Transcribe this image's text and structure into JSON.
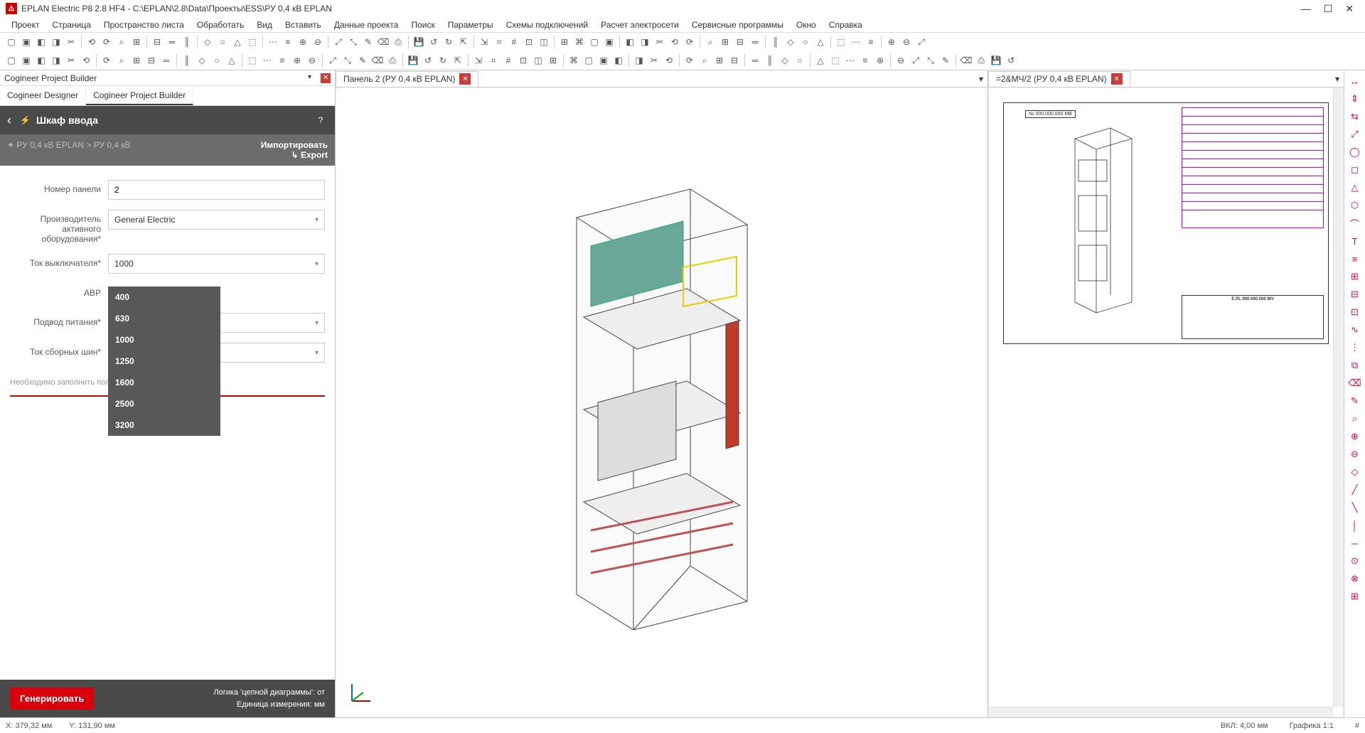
{
  "titlebar": {
    "app_title": "EPLAN Electric P8 2.8 HF4 - C:\\EPLAN\\2.8\\Data\\Проекты\\ESS\\РУ 0,4 кВ EPLAN"
  },
  "menu": [
    "Проект",
    "Страница",
    "Пространство листа",
    "Обработать",
    "Вид",
    "Вставить",
    "Данные проекта",
    "Поиск",
    "Параметры",
    "Схемы подключений",
    "Расчет электросети",
    "Сервисные программы",
    "Окно",
    "Справка"
  ],
  "left_panel": {
    "title": "Cogineer Project Builder",
    "subtabs": [
      "Cogineer Designer",
      "Cogineer Project Builder"
    ],
    "active_subtab": 1,
    "header_title": "Шкаф ввода",
    "breadcrumb": "РУ 0,4 кВ EPLAN  >  РУ 0,4 кВ",
    "import_label": "Импортировать",
    "export_label": "Export",
    "fields": {
      "panel_number": {
        "label": "Номер панели",
        "value": "2"
      },
      "manufacturer": {
        "label": "Производитель активного оборудования*",
        "value": "General Electric"
      },
      "breaker_current": {
        "label": "Ток выключателя*",
        "value": "1000",
        "options": [
          "400",
          "630",
          "1000",
          "1250",
          "1600",
          "2500",
          "3200"
        ]
      },
      "avr": {
        "label": "АВР"
      },
      "power_feed": {
        "label": "Подвод питания*",
        "value": ""
      },
      "bus_current": {
        "label": "Ток сборных шин*",
        "value": ""
      }
    },
    "hint": "Необходимо заполнить поля, помеченные звездочкой (*).",
    "generate_label": "Генерировать",
    "footer_logic": "Логика 'цепной диаграммы': от",
    "footer_unit": "Единица измерения: мм"
  },
  "center_tab": {
    "label": "Панель 2 (РУ 0,4 кВ EPLAN)"
  },
  "right_tab": {
    "label": "=2&МЧ/2 (РУ 0,4 кВ EPLAN)"
  },
  "sheet": {
    "tag": "№ 000.000.000 МВ",
    "titleblock": "E.PL 000.000.000 МЧ"
  },
  "status": {
    "x": "X: 379,32 мм",
    "y": "Y: 131,90 мм",
    "snap": "ВКЛ: 4,00 мм",
    "zoom": "Графика 1:1",
    "hash": "#"
  }
}
